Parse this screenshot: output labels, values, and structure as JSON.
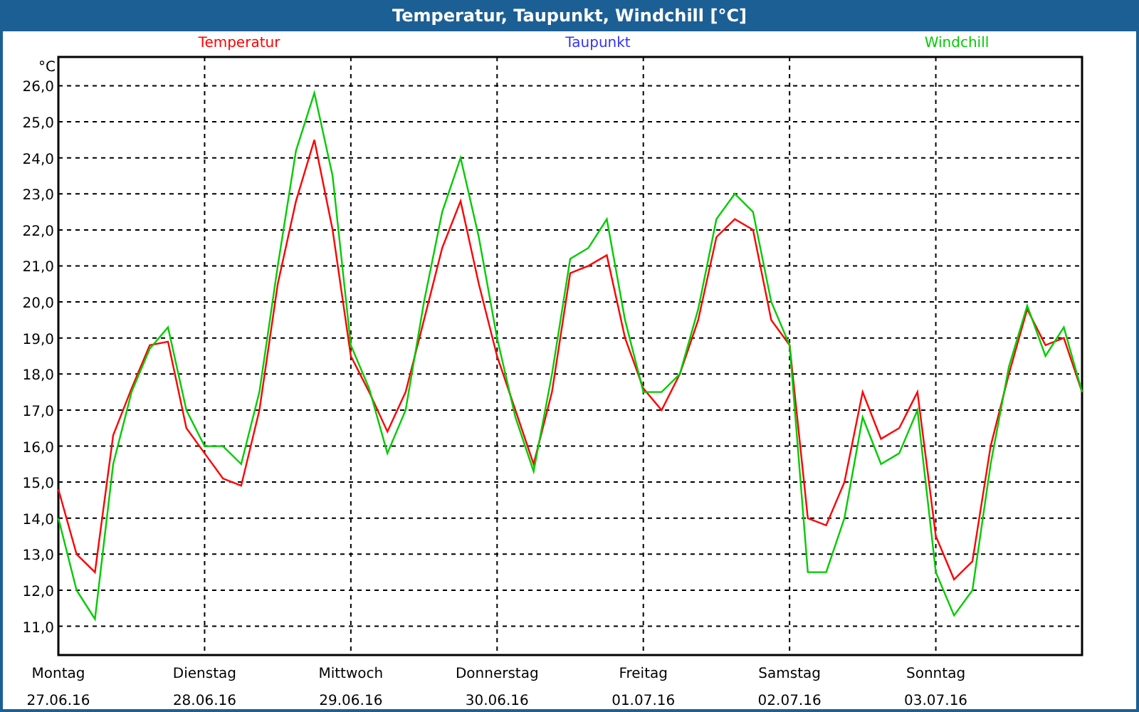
{
  "window": {
    "title": "Temperatur, Taupunkt, Windchill [°C]"
  },
  "chart": {
    "date_labels": [
      "27.06.16",
      "28.06.16",
      "29.06.16",
      "30.06.16",
      "01.07.16",
      "02.07.16",
      "03.07.16"
    ],
    "chart_data": {
      "type": "line",
      "grid": true,
      "ylabel": "°C",
      "ylim": [
        10.2,
        26.8
      ],
      "categories": [
        "Montag",
        null,
        null,
        null,
        null,
        null,
        null,
        null,
        "Dienstag",
        null,
        null,
        null,
        null,
        null,
        null,
        null,
        "Mittwoch",
        null,
        null,
        null,
        null,
        null,
        null,
        null,
        "Donnerstag",
        null,
        null,
        null,
        null,
        null,
        null,
        null,
        "Freitag",
        null,
        null,
        null,
        null,
        null,
        null,
        null,
        "Samstag",
        null,
        null,
        null,
        null,
        null,
        null,
        null,
        "Sonntag",
        null,
        null,
        null,
        null,
        null,
        null,
        null,
        null
      ],
      "yticks": [
        {
          "value": 11,
          "label": "11,0"
        },
        {
          "value": 12,
          "label": "12,0"
        },
        {
          "value": 13,
          "label": "13,0"
        },
        {
          "value": 14,
          "label": "14,0"
        },
        {
          "value": 15,
          "label": "15,0"
        },
        {
          "value": 16,
          "label": "16,0"
        },
        {
          "value": 17,
          "label": "17,0"
        },
        {
          "value": 18,
          "label": "18,0"
        },
        {
          "value": 19,
          "label": "19,0"
        },
        {
          "value": 20,
          "label": "20,0"
        },
        {
          "value": 21,
          "label": "21,0"
        },
        {
          "value": 22,
          "label": "22,0"
        },
        {
          "value": 23,
          "label": "23,0"
        },
        {
          "value": 24,
          "label": "24,0"
        },
        {
          "value": 25,
          "label": "25,0"
        },
        {
          "value": 26,
          "label": "26,0"
        }
      ],
      "series": [
        {
          "name": "Temperatur",
          "color": "#ff0000",
          "values": [
            14.8,
            13.0,
            12.5,
            16.3,
            17.6,
            18.8,
            18.9,
            16.5,
            15.8,
            15.1,
            14.9,
            17.0,
            20.5,
            22.8,
            24.5,
            22.0,
            18.5,
            17.5,
            16.4,
            17.5,
            19.5,
            21.5,
            22.8,
            20.5,
            18.5,
            17.0,
            15.5,
            17.5,
            20.8,
            21.0,
            21.3,
            19.0,
            17.6,
            17.0,
            18.0,
            19.5,
            21.8,
            22.3,
            22.0,
            19.5,
            18.8,
            14.0,
            13.8,
            15.0,
            17.5,
            16.2,
            16.5,
            17.5,
            13.5,
            12.3,
            12.8,
            16.0,
            18.0,
            19.8,
            18.8,
            19.0,
            17.5
          ]
        },
        {
          "name": "Taupunkt",
          "color": "#3333ff",
          "values": [
            null,
            null,
            null,
            null,
            null,
            null,
            null,
            null,
            null,
            null,
            null,
            null,
            null,
            null,
            null,
            null,
            null,
            null,
            null,
            null,
            null,
            null,
            null,
            null,
            null,
            null,
            null,
            null,
            null,
            null,
            null,
            null,
            null,
            null,
            null,
            null,
            null,
            null,
            null,
            null,
            null,
            null,
            null,
            null,
            null,
            null,
            null,
            null,
            null,
            null,
            null,
            null,
            null,
            null,
            null,
            null,
            null
          ]
        },
        {
          "name": "Windchill",
          "color": "#00cc00",
          "values": [
            14.0,
            12.0,
            11.2,
            15.5,
            17.5,
            18.7,
            19.3,
            17.0,
            16.0,
            16.0,
            15.5,
            17.5,
            21.0,
            24.2,
            25.8,
            23.5,
            18.8,
            17.6,
            15.8,
            17.0,
            20.0,
            22.5,
            24.0,
            21.8,
            19.0,
            16.8,
            15.3,
            18.0,
            21.2,
            21.5,
            22.3,
            19.5,
            17.5,
            17.5,
            18.0,
            19.8,
            22.3,
            23.0,
            22.5,
            20.0,
            18.8,
            12.5,
            12.5,
            14.0,
            16.8,
            15.5,
            15.8,
            17.0,
            12.5,
            11.3,
            12.0,
            15.5,
            18.2,
            19.9,
            18.5,
            19.3,
            17.5
          ]
        }
      ]
    }
  }
}
